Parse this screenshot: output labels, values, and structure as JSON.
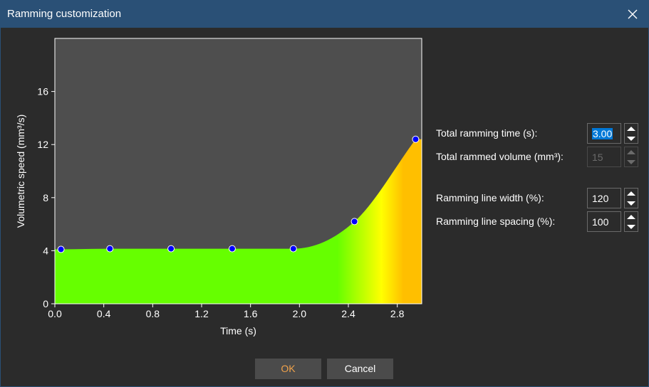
{
  "window": {
    "title": "Ramming customization"
  },
  "settings": {
    "total_time_label": "Total ramming time (s):",
    "total_time_value": "3.00",
    "total_volume_label": "Total rammed volume (mm³):",
    "total_volume_value": "15",
    "line_width_label": "Ramming line width (%):",
    "line_width_value": "120",
    "line_spacing_label": "Ramming line spacing (%):",
    "line_spacing_value": "100"
  },
  "buttons": {
    "ok": "OK",
    "cancel": "Cancel"
  },
  "colors": {
    "plot_background": "#4e4e4e",
    "fill_low": "#66ff00",
    "fill_mid": "#ffff00",
    "fill_high": "#ffbf00",
    "point": "#0000ff"
  },
  "chart_data": {
    "type": "area",
    "xlabel": "Time (s)",
    "ylabel": "Volumetric speed (mm³/s)",
    "xlim": [
      0,
      3.0
    ],
    "ylim": [
      0,
      20
    ],
    "x_ticks": [
      "0.0",
      "0.4",
      "0.8",
      "1.2",
      "1.6",
      "2.0",
      "2.4",
      "2.8"
    ],
    "y_ticks": [
      "0",
      "4",
      "8",
      "12",
      "16"
    ],
    "points": [
      {
        "x": 0.05,
        "y": 4.1
      },
      {
        "x": 0.45,
        "y": 4.15
      },
      {
        "x": 0.95,
        "y": 4.15
      },
      {
        "x": 1.45,
        "y": 4.15
      },
      {
        "x": 1.95,
        "y": 4.15
      },
      {
        "x": 2.45,
        "y": 6.2
      },
      {
        "x": 2.95,
        "y": 12.4
      }
    ]
  }
}
